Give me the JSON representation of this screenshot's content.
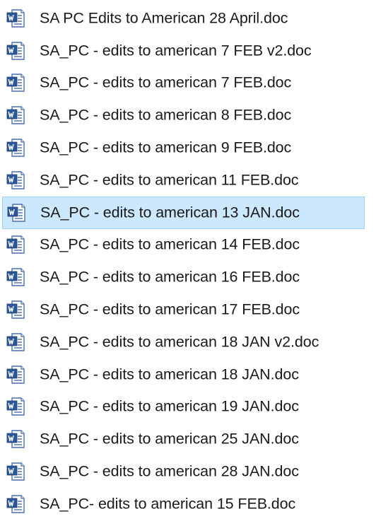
{
  "files": [
    {
      "name": "SA PC Edits to American 28 April.doc",
      "icon": "word-document-icon",
      "selected": false
    },
    {
      "name": "SA_PC - edits to american 7 FEB v2.doc",
      "icon": "word-document-icon",
      "selected": false
    },
    {
      "name": "SA_PC - edits to american 7 FEB.doc",
      "icon": "word-document-icon",
      "selected": false
    },
    {
      "name": "SA_PC - edits to american 8 FEB.doc",
      "icon": "word-document-icon",
      "selected": false
    },
    {
      "name": "SA_PC - edits to american 9 FEB.doc",
      "icon": "word-document-icon",
      "selected": false
    },
    {
      "name": "SA_PC - edits to american 11 FEB.doc",
      "icon": "word-document-icon",
      "selected": false
    },
    {
      "name": "SA_PC - edits to american 13 JAN.doc",
      "icon": "word-document-icon",
      "selected": true
    },
    {
      "name": "SA_PC - edits to american 14 FEB.doc",
      "icon": "word-document-icon",
      "selected": false
    },
    {
      "name": "SA_PC - edits to american 16 FEB.doc",
      "icon": "word-document-icon",
      "selected": false
    },
    {
      "name": "SA_PC - edits to american 17 FEB.doc",
      "icon": "word-document-icon",
      "selected": false
    },
    {
      "name": "SA_PC - edits to american 18 JAN v2.doc",
      "icon": "word-document-icon",
      "selected": false
    },
    {
      "name": "SA_PC - edits to american 18 JAN.doc",
      "icon": "word-document-icon",
      "selected": false
    },
    {
      "name": "SA_PC - edits to american 19 JAN.doc",
      "icon": "word-document-icon",
      "selected": false
    },
    {
      "name": "SA_PC - edits to american 25 JAN.doc",
      "icon": "word-document-icon",
      "selected": false
    },
    {
      "name": "SA_PC - edits to american 28 JAN.doc",
      "icon": "word-document-icon",
      "selected": false
    },
    {
      "name": "SA_PC- edits to american 15 FEB.doc",
      "icon": "word-document-icon",
      "selected": false
    }
  ],
  "colors": {
    "selection_background": "#cce8ff",
    "selection_border": "#99d1ff",
    "word_blue": "#2b579a",
    "text": "#1a1a1a"
  }
}
